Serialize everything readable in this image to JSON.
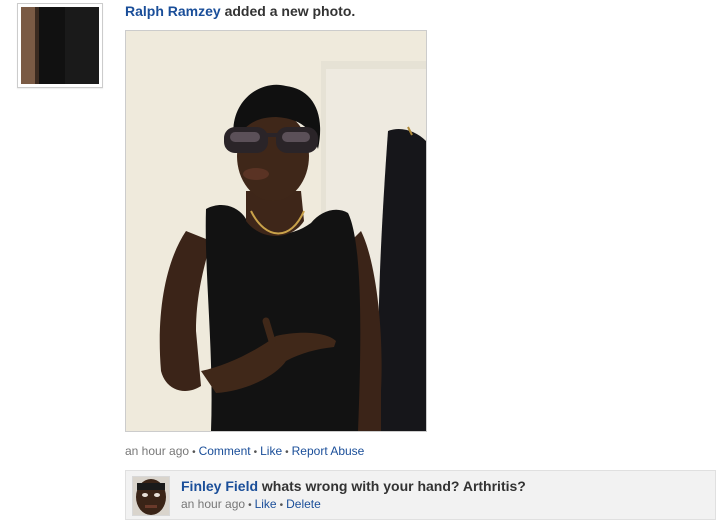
{
  "story": {
    "actor_name": "Ralph Ramzey",
    "action_text": " added a new photo."
  },
  "photo_meta": {
    "timestamp": "an hour ago",
    "comment_label": "Comment",
    "like_label": "Like",
    "report_label": "Report Abuse",
    "separator": "•"
  },
  "comment": {
    "author": "Finley Field",
    "text": " whats wrong with your hand? Arthritis?",
    "timestamp": "an hour ago",
    "like_label": "Like",
    "delete_label": "Delete",
    "separator": "•"
  },
  "colors": {
    "link": "#1a4e99",
    "meta_text": "#777777",
    "comment_bg": "#f2f2f2"
  }
}
